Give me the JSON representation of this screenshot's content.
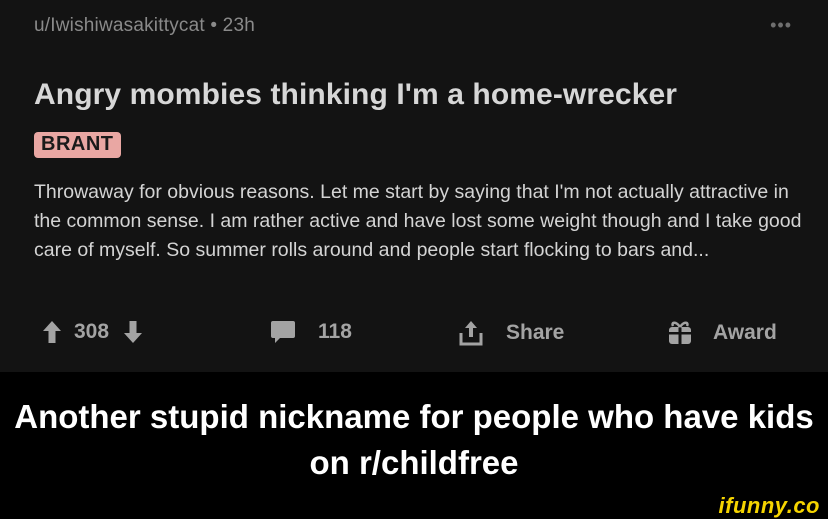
{
  "post": {
    "author": "u/Iwishiwasakittycat",
    "separator": "•",
    "time": "23h",
    "more": "•••",
    "title": "Angry mombies thinking I'm a home-wrecker",
    "flair": "BRANT",
    "body": "Throwaway for obvious reasons.  Let me start by saying that I'm not actually attractive in the common sense. I am rather active and have lost some weight though and I take good care of myself.  So summer rolls around and people start flocking to bars and...",
    "votes": "308",
    "comments": "118",
    "share_label": "Share",
    "award_label": "Award"
  },
  "caption": "Another stupid nickname for people who have kids on r/childfree",
  "watermark": "ifunny.co",
  "colors": {
    "post_bg": "#131313",
    "flair_bg": "#e9a7a3",
    "watermark": "#f5d400"
  }
}
